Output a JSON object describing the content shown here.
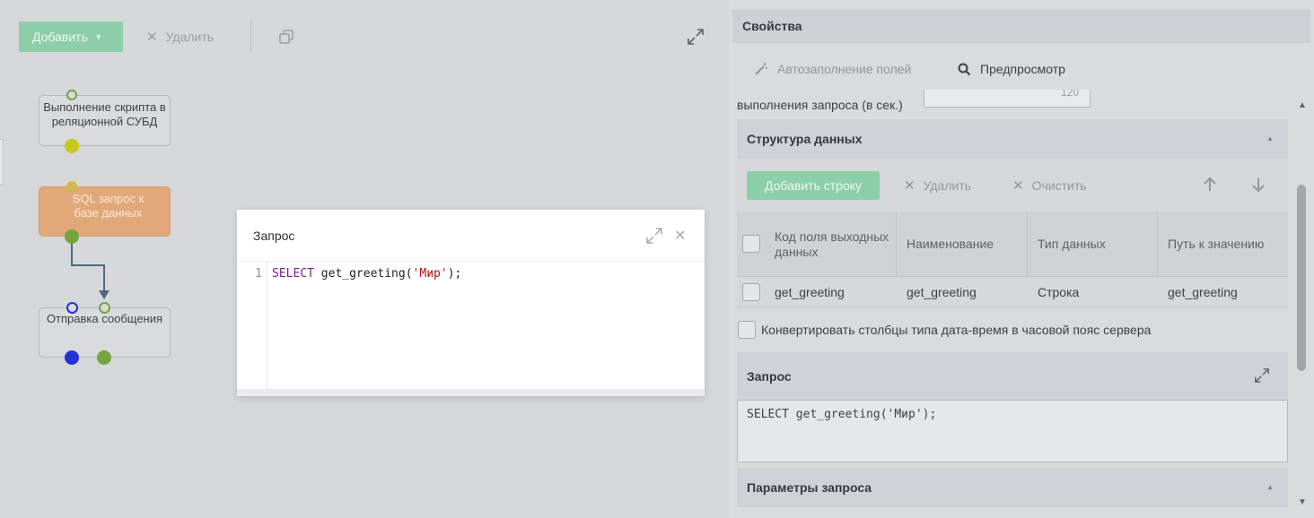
{
  "toolbar": {
    "add_label": "Добавить",
    "delete_label": "Удалить"
  },
  "workflow": {
    "nodes": [
      {
        "label": "Выполнение скрипта в реляционной СУБД"
      },
      {
        "label": "SQL запрос к базе данных"
      },
      {
        "label": "Отправка сообщения"
      }
    ],
    "colors": {
      "port_yellow": "#c7c91a",
      "port_green": "#76a43f",
      "port_blue": "#2230d6",
      "connector": "#4d6a7e",
      "active_node": "#e1a979"
    }
  },
  "modal": {
    "title": "Запрос",
    "line_number": "1",
    "code": {
      "keyword": "SELECT",
      "func": " get_greeting(",
      "string": "'Мир'",
      "tail": ");"
    }
  },
  "properties": {
    "title": "Свойства",
    "tabs": {
      "autofill": "Автозаполнение полей",
      "preview": "Предпросмотр"
    },
    "timeout_label": "выполнения запроса (в сек.)",
    "timeout_value": "120",
    "data_structure": {
      "title": "Структура данных",
      "add_row_label": "Добавить строку",
      "delete_label": "Удалить",
      "clear_label": "Очистить",
      "columns": [
        "Код поля выходных данных",
        "Наименование",
        "Тип данных",
        "Путь к значению"
      ],
      "rows": [
        {
          "code": "get_greeting",
          "name": "get_greeting",
          "type": "Строка",
          "path": "get_greeting"
        }
      ]
    },
    "convert_label": "Конвертировать столбцы типа дата-время в часовой пояс сервера",
    "query": {
      "title": "Запрос",
      "text": "SELECT get_greeting('Мир');"
    },
    "params": {
      "title": "Параметры запроса"
    }
  },
  "accent_color": "#8dcfa8"
}
